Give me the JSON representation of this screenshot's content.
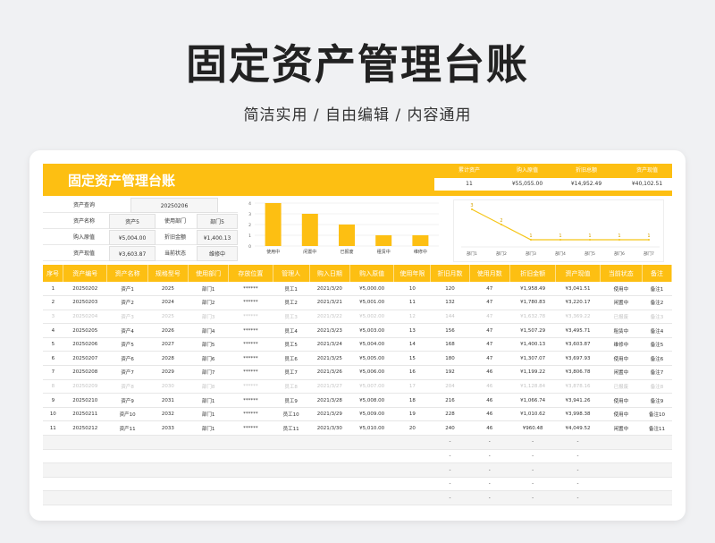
{
  "hero": {
    "title": "固定资产管理台账",
    "subtitle": "简洁实用 / 自由编辑 / 内容通用"
  },
  "sheet": {
    "title": "固定资产管理台账",
    "kpis": [
      {
        "label": "累计资产",
        "value": "11"
      },
      {
        "label": "购入原值",
        "value": "¥55,055.00"
      },
      {
        "label": "折旧总额",
        "value": "¥14,952.49"
      },
      {
        "label": "资产现值",
        "value": "¥40,102.51"
      }
    ],
    "query": {
      "asset_query_label": "资产查询",
      "asset_query_value": "20250206",
      "name_label": "资产名称",
      "name_value": "资产5",
      "dept_label": "使用部门",
      "dept_value": "部门5",
      "purchase_label": "购入原值",
      "purchase_value": "¥5,004.00",
      "depr_label": "折旧金额",
      "depr_value": "¥1,400.13",
      "current_label": "资产现值",
      "current_value": "¥3,603.87",
      "status_label": "当前状态",
      "status_value": "维修中"
    },
    "bar_chart": {
      "y_ticks": [
        "4",
        "3",
        "2",
        "1",
        "0"
      ]
    },
    "line_chart": {
      "labels": [
        "部门1",
        "部门2",
        "部门3",
        "部门4",
        "部门5",
        "部门6",
        "部门7"
      ]
    }
  },
  "chart_data": [
    {
      "type": "bar",
      "categories": [
        "使用中",
        "闲置中",
        "已报废",
        "租赁中",
        "维修中"
      ],
      "values": [
        4,
        3,
        2,
        1,
        1
      ],
      "ylim": [
        0,
        4
      ]
    },
    {
      "type": "line",
      "categories": [
        "部门1",
        "部门2",
        "部门3",
        "部门4",
        "部门5",
        "部门6",
        "部门7"
      ],
      "values": [
        3,
        2,
        1,
        1,
        1,
        1,
        1
      ],
      "data_labels": [
        "3",
        "2",
        "1",
        "1",
        "1",
        "1",
        "1"
      ]
    }
  ],
  "table": {
    "headers": [
      "序号",
      "资产编号",
      "资产名称",
      "规格型号",
      "使用部门",
      "存放位置",
      "管理人",
      "购入日期",
      "购入原值",
      "使用年限",
      "折旧月数",
      "使用月数",
      "折旧金额",
      "资产现值",
      "当前状态",
      "备注"
    ],
    "rows": [
      [
        "1",
        "20250202",
        "资产1",
        "2025",
        "部门1",
        "******",
        "员工1",
        "2021/3/20",
        "¥5,000.00",
        "10",
        "120",
        "47",
        "¥1,958.49",
        "¥3,041.51",
        "使用中",
        "备注1"
      ],
      [
        "2",
        "20250203",
        "资产2",
        "2024",
        "部门2",
        "******",
        "员工2",
        "2021/3/21",
        "¥5,001.00",
        "11",
        "132",
        "47",
        "¥1,780.83",
        "¥3,220.17",
        "闲置中",
        "备注2"
      ],
      [
        "3",
        "20250204",
        "资产3",
        "2025",
        "部门3",
        "******",
        "员工3",
        "2021/3/22",
        "¥5,002.00",
        "12",
        "144",
        "47",
        "¥1,632.78",
        "¥3,369.22",
        "已报废",
        "备注3"
      ],
      [
        "4",
        "20250205",
        "资产4",
        "2026",
        "部门4",
        "******",
        "员工4",
        "2021/3/23",
        "¥5,003.00",
        "13",
        "156",
        "47",
        "¥1,507.29",
        "¥3,495.71",
        "租赁中",
        "备注4"
      ],
      [
        "5",
        "20250206",
        "资产5",
        "2027",
        "部门5",
        "******",
        "员工5",
        "2021/3/24",
        "¥5,004.00",
        "14",
        "168",
        "47",
        "¥1,400.13",
        "¥3,603.87",
        "维修中",
        "备注5"
      ],
      [
        "6",
        "20250207",
        "资产6",
        "2028",
        "部门6",
        "******",
        "员工6",
        "2021/3/25",
        "¥5,005.00",
        "15",
        "180",
        "47",
        "¥1,307.07",
        "¥3,697.93",
        "使用中",
        "备注6"
      ],
      [
        "7",
        "20250208",
        "资产7",
        "2029",
        "部门7",
        "******",
        "员工7",
        "2021/3/26",
        "¥5,006.00",
        "16",
        "192",
        "46",
        "¥1,199.22",
        "¥3,806.78",
        "闲置中",
        "备注7"
      ],
      [
        "8",
        "20250209",
        "资产8",
        "2030",
        "部门8",
        "******",
        "员工8",
        "2021/3/27",
        "¥5,007.00",
        "17",
        "204",
        "46",
        "¥1,128.84",
        "¥3,878.16",
        "已报废",
        "备注8"
      ],
      [
        "9",
        "20250210",
        "资产9",
        "2031",
        "部门1",
        "******",
        "员工9",
        "2021/3/28",
        "¥5,008.00",
        "18",
        "216",
        "46",
        "¥1,066.74",
        "¥3,941.26",
        "使用中",
        "备注9"
      ],
      [
        "10",
        "20250211",
        "资产10",
        "2032",
        "部门1",
        "******",
        "员工10",
        "2021/3/29",
        "¥5,009.00",
        "19",
        "228",
        "46",
        "¥1,010.62",
        "¥3,998.38",
        "使用中",
        "备注10"
      ],
      [
        "11",
        "20250212",
        "资产11",
        "2033",
        "部门1",
        "******",
        "员工11",
        "2021/3/30",
        "¥5,010.00",
        "20",
        "240",
        "46",
        "¥960.48",
        "¥4,049.52",
        "闲置中",
        "备注11"
      ],
      [
        "",
        "",
        "",
        "",
        "",
        "",
        "",
        "",
        "",
        "",
        "-",
        "-",
        "-",
        "-",
        "",
        ""
      ],
      [
        "",
        "",
        "",
        "",
        "",
        "",
        "",
        "",
        "",
        "",
        "-",
        "-",
        "-",
        "-",
        "",
        ""
      ],
      [
        "",
        "",
        "",
        "",
        "",
        "",
        "",
        "",
        "",
        "",
        "-",
        "-",
        "-",
        "-",
        "",
        ""
      ],
      [
        "",
        "",
        "",
        "",
        "",
        "",
        "",
        "",
        "",
        "",
        "-",
        "-",
        "-",
        "-",
        "",
        ""
      ],
      [
        "",
        "",
        "",
        "",
        "",
        "",
        "",
        "",
        "",
        "",
        "-",
        "-",
        "-",
        "-",
        "",
        ""
      ]
    ],
    "faded_rows": [
      3,
      8
    ]
  },
  "colors": {
    "accent": "#fdbf12",
    "bar": "#fdbf12",
    "line": "#f5c518"
  }
}
